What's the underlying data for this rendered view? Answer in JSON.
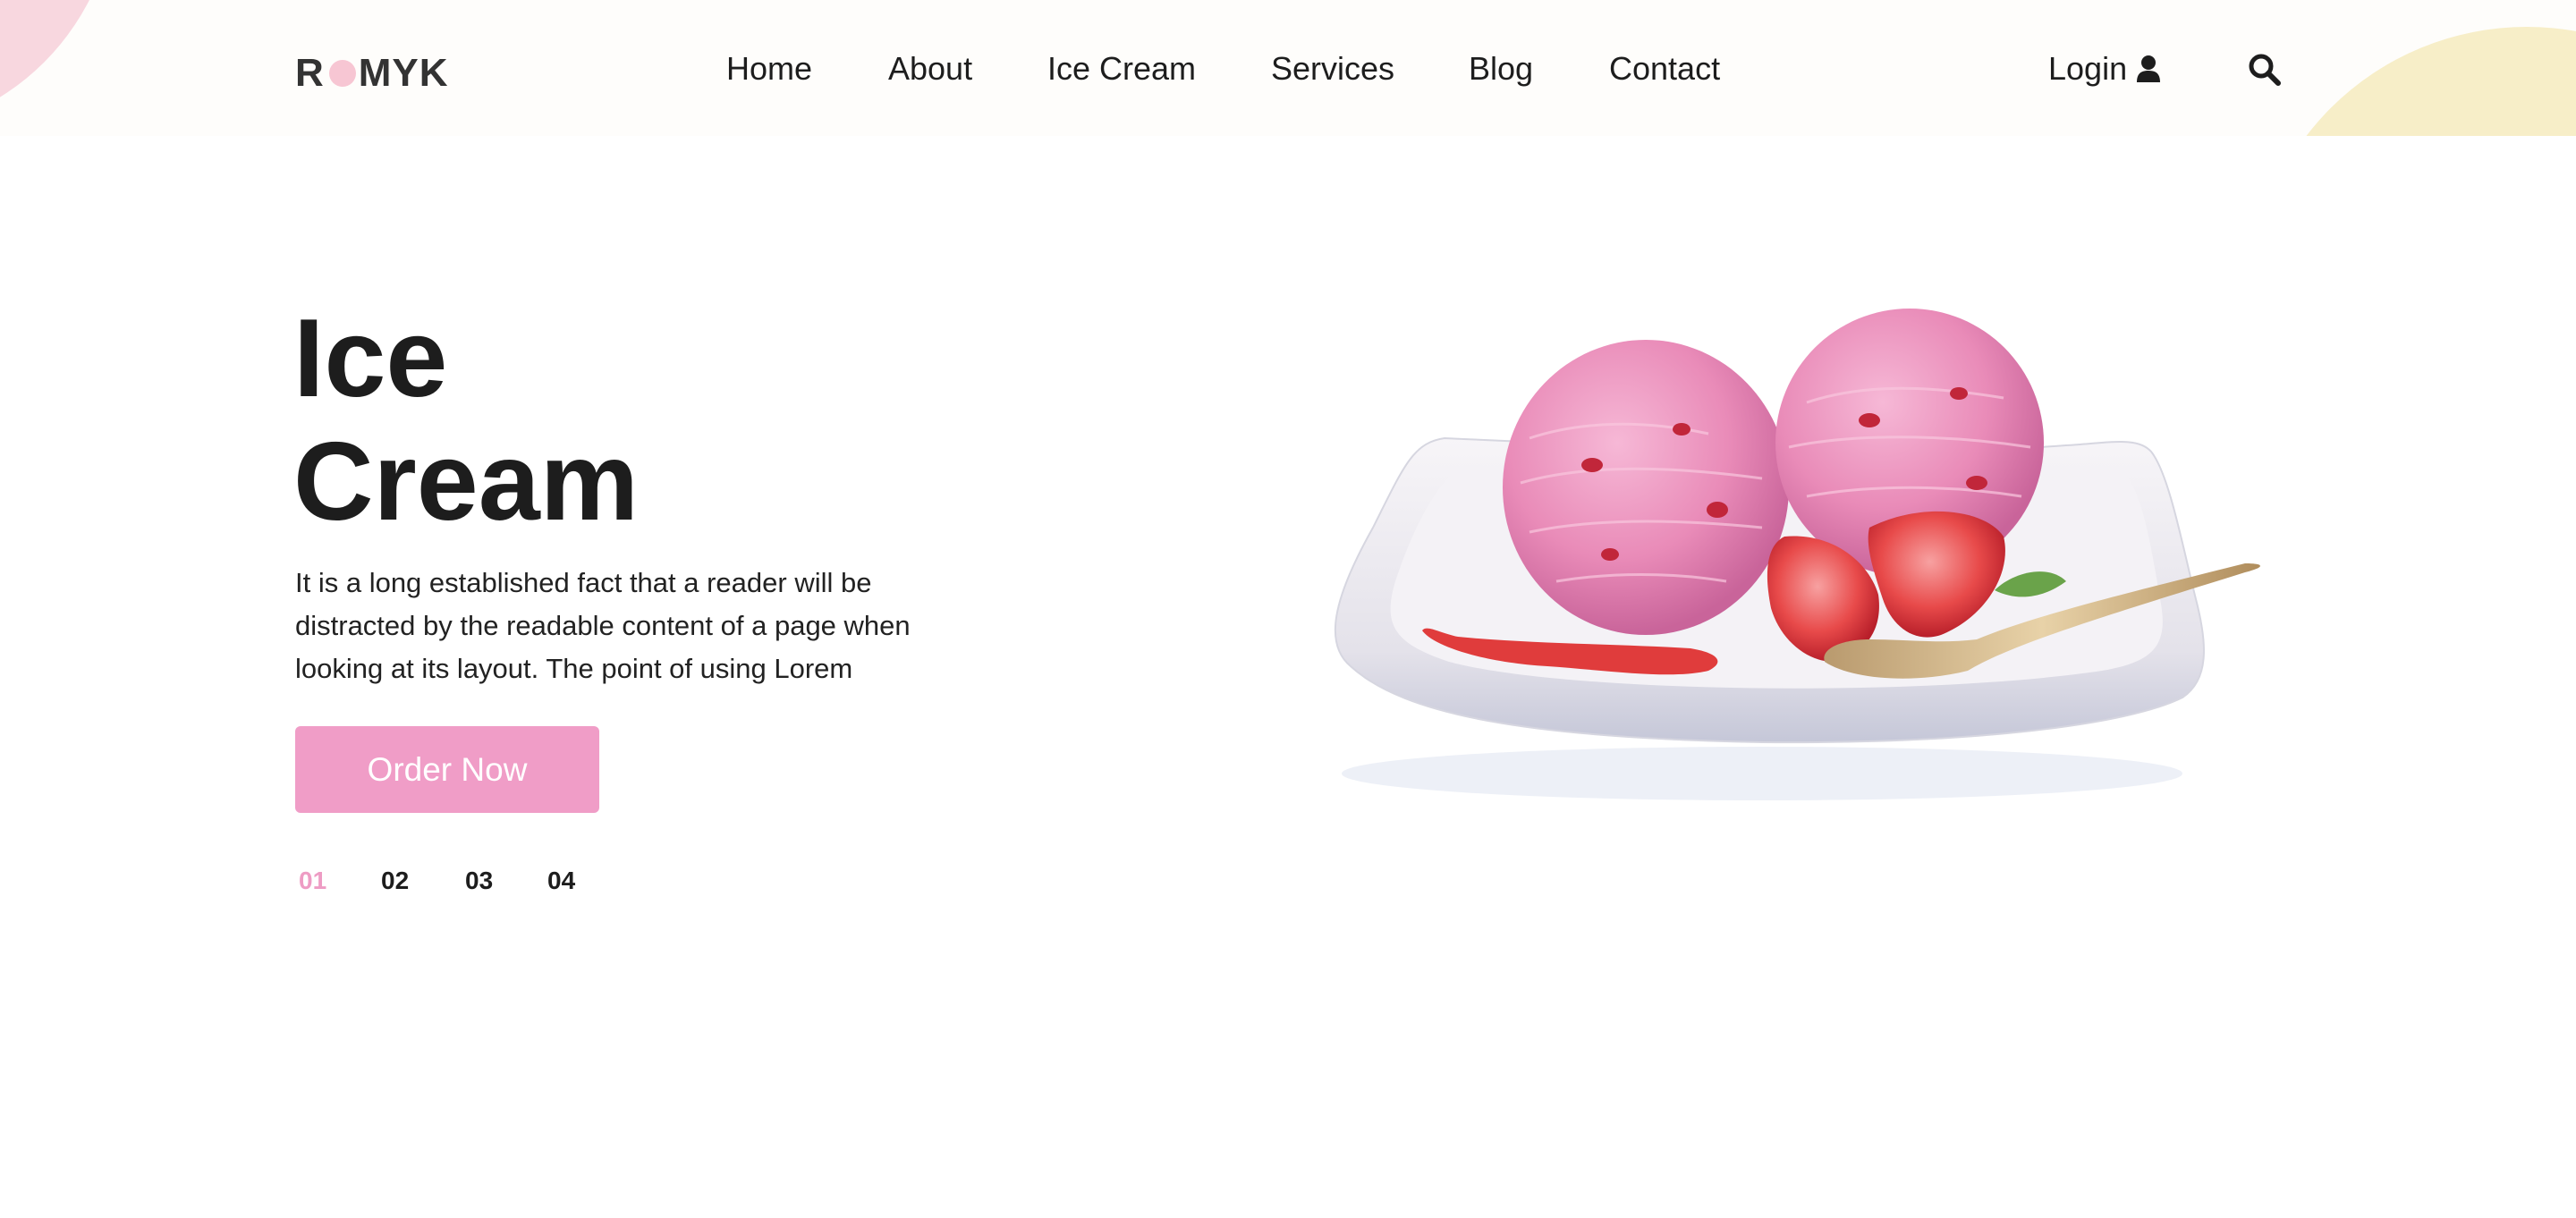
{
  "brand": {
    "logo_left": "R",
    "logo_right": "MYK"
  },
  "nav": {
    "items": [
      {
        "label": "Home"
      },
      {
        "label": "About"
      },
      {
        "label": "Ice Cream"
      },
      {
        "label": "Services"
      },
      {
        "label": "Blog"
      },
      {
        "label": "Contact"
      }
    ],
    "login_label": "Login"
  },
  "hero": {
    "title_line1": "Ice",
    "title_line2": "Cream",
    "description": "It is a long established fact that a reader will be distracted by the readable content of a page when looking at its layout. The point of using Lorem",
    "cta_label": "Order Now"
  },
  "slider": {
    "pages": [
      "01",
      "02",
      "03",
      "04"
    ],
    "active_index": 0
  },
  "icons": {
    "login": "user-icon",
    "search": "search-icon",
    "hero": "ice-cream-plate-image"
  },
  "colors": {
    "accent_pink": "#f09dc7",
    "active_slide": "#ee9cc4",
    "deco_pink": "#f8d7df",
    "deco_yellow": "#f7eec8"
  }
}
